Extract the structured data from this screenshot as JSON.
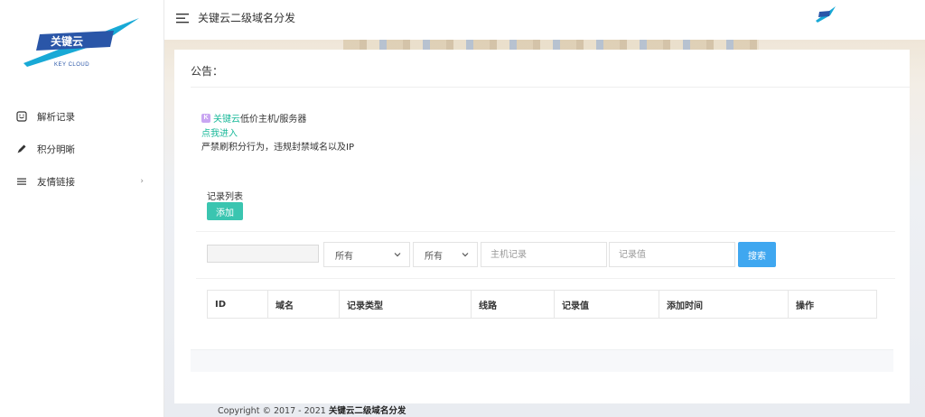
{
  "brand": {
    "logo_text": "关键云",
    "logo_subtext": "KEY CLOUD",
    "colors": {
      "primary": "#2a56a8",
      "accent": "#18a9d6",
      "teal": "#3ac5b0",
      "blue_button": "#3fa7f0"
    }
  },
  "sidebar": {
    "items": [
      {
        "label": "解析记录",
        "icon": "record-icon"
      },
      {
        "label": "积分明晰",
        "icon": "pencil-icon"
      },
      {
        "label": "友情链接",
        "icon": "list-icon",
        "arrow": "›"
      }
    ]
  },
  "header": {
    "title": "关键云二级域名分发"
  },
  "notice": {
    "title": "公告：",
    "ad_brand": "关键云",
    "ad_text": "低价主机/服务器",
    "ad_link": "点我进入",
    "rule": "严禁刷积分行为，违规封禁域名以及IP"
  },
  "records": {
    "title": "记录列表",
    "add_label": "添加",
    "filters": {
      "select1": "所有",
      "select2": "所有",
      "host_placeholder": "主机记录",
      "value_placeholder": "记录值",
      "search_label": "搜索"
    },
    "columns": [
      "ID",
      "域名",
      "记录类型",
      "线路",
      "记录值",
      "添加时间",
      "操作"
    ]
  },
  "footer": {
    "copyright_prefix": "Copyright © 2017 - 2021",
    "copyright_site": "关键云二级域名分发"
  }
}
